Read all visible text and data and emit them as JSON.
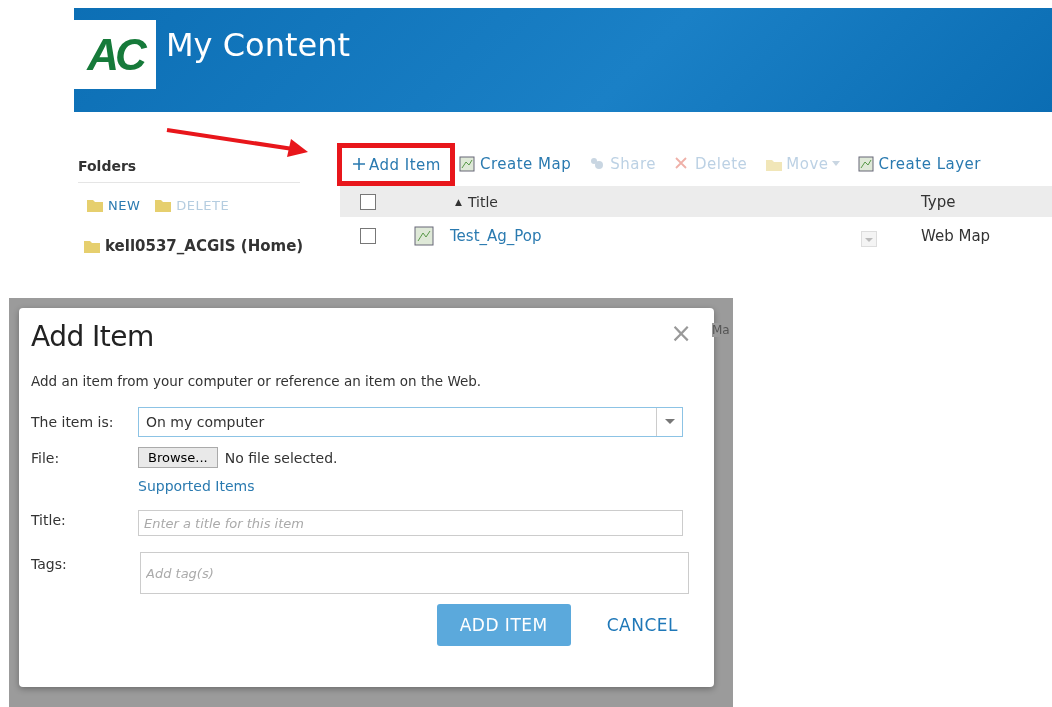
{
  "header": {
    "logo_text": "AC",
    "title": "My Content"
  },
  "sidebar": {
    "heading": "Folders",
    "actions": [
      {
        "label": "NEW",
        "disabled": false
      },
      {
        "label": "DELETE",
        "disabled": true
      }
    ],
    "folders": [
      {
        "label": "kell0537_ACGIS (Home)"
      }
    ]
  },
  "toolbar": [
    {
      "kind": "add",
      "label": "Add Item",
      "disabled": false,
      "highlighted": true
    },
    {
      "kind": "map",
      "label": "Create Map",
      "disabled": false,
      "highlighted": false
    },
    {
      "kind": "share",
      "label": "Share",
      "disabled": true,
      "highlighted": false
    },
    {
      "kind": "delete",
      "label": "Delete",
      "disabled": true,
      "highlighted": false
    },
    {
      "kind": "move",
      "label": "Move",
      "disabled": true,
      "highlighted": false
    },
    {
      "kind": "layer",
      "label": "Create Layer",
      "disabled": false,
      "highlighted": false
    }
  ],
  "table": {
    "select_all_checked": false,
    "columns": [
      {
        "label": "Title",
        "sort": "▲"
      },
      {
        "label": "Type"
      }
    ],
    "rows": [
      {
        "checked": false,
        "title": "Test_Ag_Pop",
        "type": "Web Map"
      }
    ]
  },
  "background_fragment": "Ma",
  "dialog": {
    "title": "Add Item",
    "close": "×",
    "intro": "Add an item from your computer or reference an item on the Web.",
    "item_is": {
      "label": "The item is:",
      "value": "On my computer"
    },
    "file": {
      "label": "File:",
      "button": "Browse...",
      "status": "No file selected."
    },
    "supported_link": "Supported Items",
    "title_field": {
      "label": "Title:",
      "placeholder": "Enter a title for this item"
    },
    "tags_field": {
      "label": "Tags:",
      "placeholder": "Add tag(s)"
    },
    "buttons": [
      {
        "kind": "primary",
        "label": "ADD ITEM"
      },
      {
        "kind": "link",
        "label": "CANCEL"
      }
    ]
  }
}
